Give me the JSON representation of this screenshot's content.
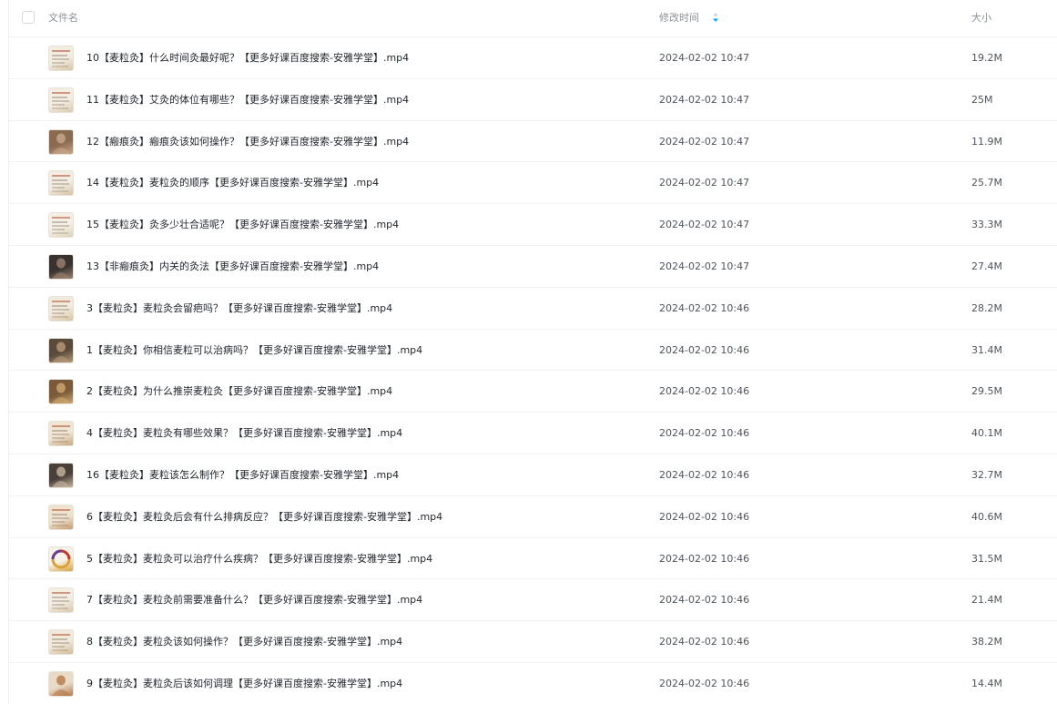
{
  "header": {
    "col_name": "文件名",
    "col_time": "修改时间",
    "col_size": "大小",
    "sort_icon": "sort-arrows-icon",
    "sort_color": "#06a7ff"
  },
  "files": [
    {
      "name": "10【麦粒灸】什么时间灸最好呢？【更多好课百度搜索-安雅学堂】.mp4",
      "time": "2024-02-02 10:47",
      "size": "19.2M",
      "thumb": "slide-thumbnail",
      "thumb_colors": [
        "#f3ece0",
        "#d8c6a8"
      ]
    },
    {
      "name": "11【麦粒灸】艾灸的体位有哪些？【更多好课百度搜索-安雅学堂】.mp4",
      "time": "2024-02-02 10:47",
      "size": "25M",
      "thumb": "slide-thumbnail",
      "thumb_colors": [
        "#f4ede2",
        "#dccbb0"
      ]
    },
    {
      "name": "12【瘢痕灸】瘢痕灸该如何操作？【更多好课百度搜索-安雅学堂】.mp4",
      "time": "2024-02-02 10:47",
      "size": "11.9M",
      "thumb": "photo-thumbnail",
      "thumb_colors": [
        "#8a6b52",
        "#c9a88a"
      ]
    },
    {
      "name": "14【麦粒灸】麦粒灸的顺序【更多好课百度搜索-安雅学堂】.mp4",
      "time": "2024-02-02 10:47",
      "size": "25.7M",
      "thumb": "slide-thumbnail",
      "thumb_colors": [
        "#f3ece0",
        "#d6c3a5"
      ]
    },
    {
      "name": "15【麦粒灸】灸多少壮合适呢？【更多好课百度搜索-安雅学堂】.mp4",
      "time": "2024-02-02 10:47",
      "size": "33.3M",
      "thumb": "slide-thumbnail",
      "thumb_colors": [
        "#f5efe5",
        "#ddd0b8"
      ]
    },
    {
      "name": "13【非瘢痕灸】内关的灸法【更多好课百度搜索-安雅学堂】.mp4",
      "time": "2024-02-02 10:47",
      "size": "27.4M",
      "thumb": "photo-thumbnail",
      "thumb_colors": [
        "#3a3230",
        "#9c8270"
      ]
    },
    {
      "name": "3【麦粒灸】麦粒灸会留疤吗？【更多好课百度搜索-安雅学堂】.mp4",
      "time": "2024-02-02 10:46",
      "size": "28.2M",
      "thumb": "slide-thumbnail",
      "thumb_colors": [
        "#f2eadc",
        "#d9c4a2"
      ]
    },
    {
      "name": "1【麦粒灸】你相信麦粒可以治病吗？【更多好课百度搜索-安雅学堂】.mp4",
      "time": "2024-02-02 10:46",
      "size": "31.4M",
      "thumb": "photo-thumbnail",
      "thumb_colors": [
        "#5a4a3c",
        "#b89a78"
      ]
    },
    {
      "name": "2【麦粒灸】为什么推崇麦粒灸【更多好课百度搜索-安雅学堂】.mp4",
      "time": "2024-02-02 10:46",
      "size": "29.5M",
      "thumb": "photo-thumbnail",
      "thumb_colors": [
        "#7a5a3a",
        "#d0a870"
      ]
    },
    {
      "name": "4【麦粒灸】麦粒灸有哪些效果？【更多好课百度搜索-安雅学堂】.mp4",
      "time": "2024-02-02 10:46",
      "size": "40.1M",
      "thumb": "slide-thumbnail",
      "thumb_colors": [
        "#f1e6d3",
        "#c9a77e"
      ]
    },
    {
      "name": "16【麦粒灸】麦粒该怎么制作？【更多好课百度搜索-安雅学堂】.mp4",
      "time": "2024-02-02 10:46",
      "size": "32.7M",
      "thumb": "photo-thumbnail",
      "thumb_colors": [
        "#4a403a",
        "#c8b4a0"
      ]
    },
    {
      "name": "6【麦粒灸】麦粒灸后会有什么排病反应？【更多好课百度搜索-安雅学堂】.mp4",
      "time": "2024-02-02 10:46",
      "size": "40.6M",
      "thumb": "slide-thumbnail",
      "thumb_colors": [
        "#efe3cf",
        "#c89d70"
      ]
    },
    {
      "name": "5【麦粒灸】麦粒灸可以治疗什么疾病？【更多好课百度搜索-安雅学堂】.mp4",
      "time": "2024-02-02 10:46",
      "size": "31.5M",
      "thumb": "diagram-thumbnail",
      "thumb_colors": [
        "#f6f2ea",
        "#d9a13a"
      ]
    },
    {
      "name": "7【麦粒灸】麦粒灸前需要准备什么？【更多好课百度搜索-安雅学堂】.mp4",
      "time": "2024-02-02 10:46",
      "size": "21.4M",
      "thumb": "slide-thumbnail",
      "thumb_colors": [
        "#f4ede2",
        "#dac8aa"
      ]
    },
    {
      "name": "8【麦粒灸】麦粒灸该如何操作？【更多好课百度搜索-安雅学堂】.mp4",
      "time": "2024-02-02 10:46",
      "size": "38.2M",
      "thumb": "slide-thumbnail",
      "thumb_colors": [
        "#f2e9da",
        "#d3bb96"
      ]
    },
    {
      "name": "9【麦粒灸】麦粒灸后该如何调理【更多好课百度搜索-安雅学堂】.mp4",
      "time": "2024-02-02 10:46",
      "size": "14.4M",
      "thumb": "photo-thumbnail",
      "thumb_colors": [
        "#e8dcc8",
        "#b8784a"
      ]
    }
  ]
}
